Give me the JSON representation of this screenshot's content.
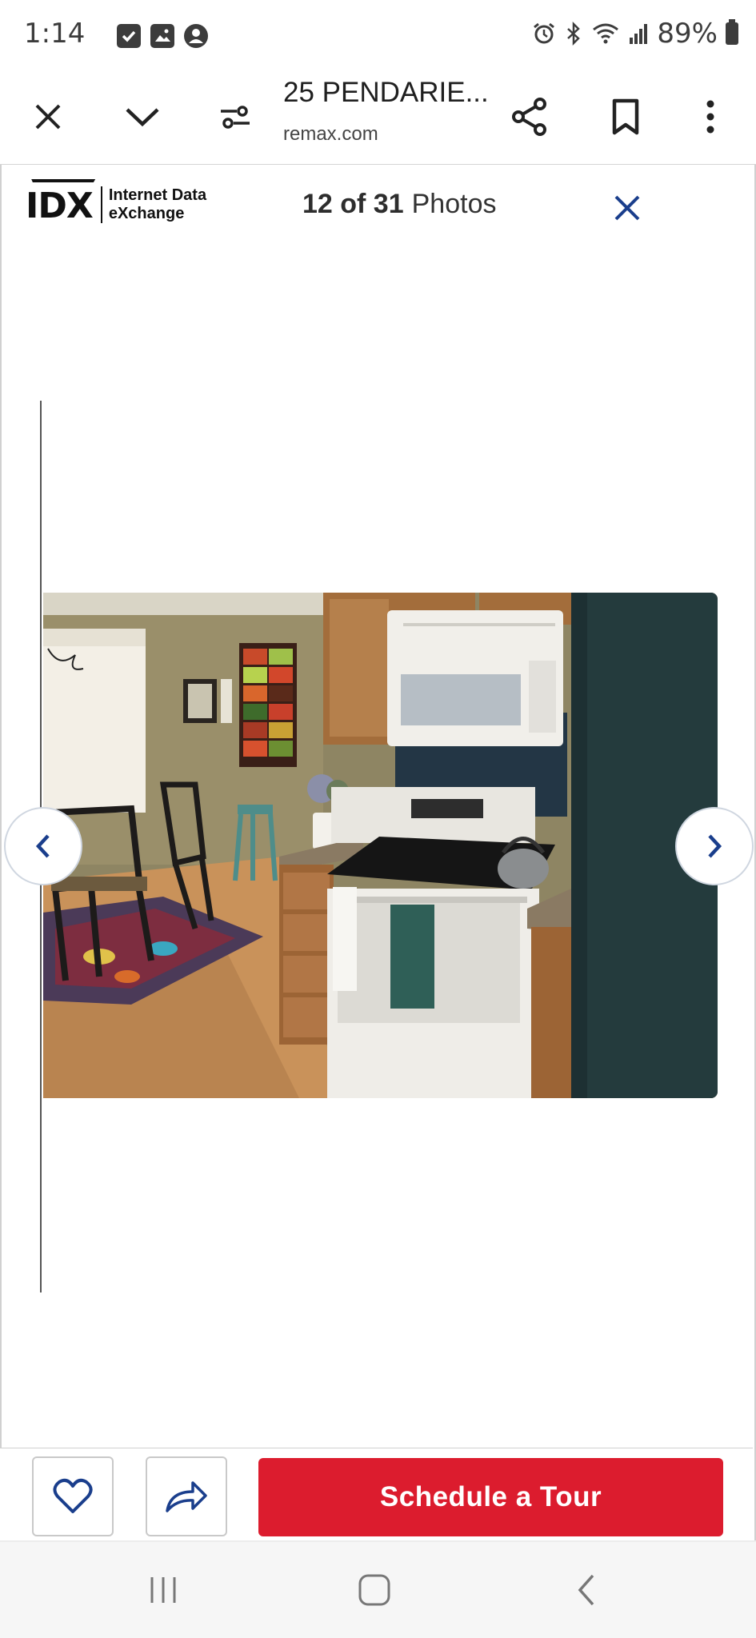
{
  "status_bar": {
    "time": "1:14",
    "battery_percent": "89%",
    "left_icons": [
      "checkbox-icon",
      "gallery-icon",
      "account-icon"
    ],
    "right_icons": [
      "alarm-icon",
      "bluetooth-icon",
      "wifi-icon",
      "signal-icon",
      "battery-icon"
    ]
  },
  "toolbar": {
    "title": "25 PENDARIE...",
    "domain": "remax.com",
    "icons": [
      "close-icon",
      "chevron-down-icon",
      "tune-icon",
      "share-icon",
      "bookmark-icon",
      "more-vert-icon"
    ]
  },
  "gallery": {
    "logo_mark": "IDX",
    "logo_line1": "Internet Data",
    "logo_line2": "eXchange",
    "counter": "12 of 31",
    "counter_suffix": "Photos",
    "accent_color": "#1a3e8c"
  },
  "actions": {
    "tour_label": "Schedule a Tour",
    "tour_color": "#dc1c2e"
  },
  "android_nav": {
    "icons": [
      "recents-icon",
      "home-icon",
      "back-icon"
    ]
  }
}
